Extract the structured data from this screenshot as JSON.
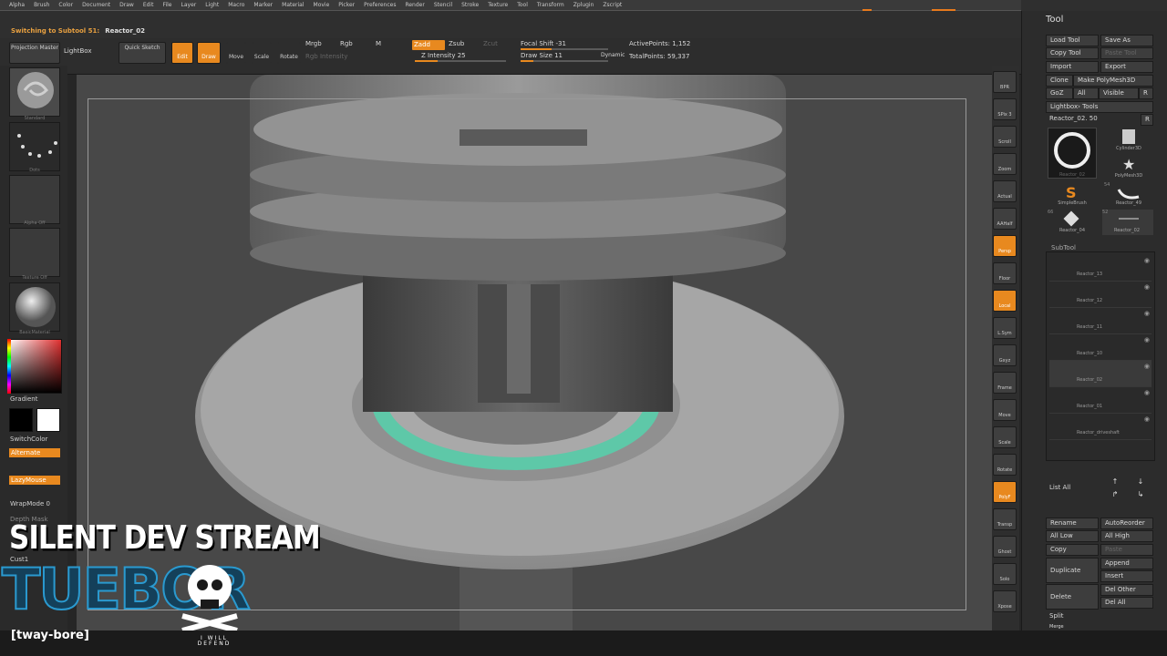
{
  "menu": {
    "items": [
      "Alpha",
      "Brush",
      "Color",
      "Document",
      "Draw",
      "Edit",
      "File",
      "Layer",
      "Light",
      "Macro",
      "Marker",
      "Material",
      "Movie",
      "Picker",
      "Preferences",
      "Render",
      "Stencil",
      "Stroke",
      "Texture",
      "Tool",
      "Transform",
      "Zplugin",
      "Zscript"
    ]
  },
  "status": {
    "prefix": "Switching to Subtool 51:",
    "subtool_name": "Reactor_02"
  },
  "toolbar": {
    "projection_master": "Projection Master",
    "lightbox": "LightBox",
    "quick_sketch": "Quick Sketch",
    "edit": "Edit",
    "draw": "Draw",
    "move": "Move",
    "scale": "Scale",
    "rotate": "Rotate",
    "mrgb": "Mrgb",
    "rgb": "Rgb",
    "m": "M",
    "rgb_intensity": "Rgb Intensity",
    "zadd": "Zadd",
    "zsub": "Zsub",
    "zcut": "Zcut",
    "z_intensity": "Z Intensity 25",
    "focal_shift": "Focal Shift -31",
    "draw_size": "Draw Size 11",
    "dynamic": "Dynamic",
    "active_points": "ActivePoints: 1,152",
    "total_points": "TotalPoints: 59,337",
    "z_intensity_level": 0.25,
    "focal_shift_level": 0.35,
    "draw_size_level": 0.15
  },
  "left_shelf": {
    "brush_label": "Standard",
    "stroke_label": "Dots",
    "alpha_label": "Alpha Off",
    "texture_label": "Texture Off",
    "material_label": "BasicMaterial",
    "gradient": "Gradient",
    "switch_color": "SwitchColor",
    "alternate": "Alternate",
    "lazy_mouse": "LazyMouse",
    "wrap_mode": "WrapMode 0",
    "depth_mask": "Depth Mask",
    "cust1": "Cust1"
  },
  "right_strip": [
    "BPR",
    "SPix 3",
    "Scroll",
    "Zoom",
    "Actual",
    "AAHalf",
    "Persp",
    "Floor",
    "Local",
    "L.Sym",
    "Gxyz",
    "Frame",
    "Move",
    "Scale",
    "Rotate",
    "PolyF",
    "Transp",
    "Ghost",
    "Solo",
    "Xpose"
  ],
  "tool_panel": {
    "title": "Tool",
    "load_tool": "Load Tool",
    "save_as": "Save As",
    "copy_tool": "Copy Tool",
    "paste_tool": "Paste Tool",
    "import": "Import",
    "export": "Export",
    "clone": "Clone",
    "make_polymesh": "Make PolyMesh3D",
    "goz": "GoZ",
    "all": "All",
    "visible": "Visible",
    "r": "R",
    "lightbox_tools": "Lightbox› Tools",
    "current_tool": "Reactor_02. 50",
    "thumbs": [
      {
        "label": "Reactor_02"
      },
      {
        "label": "Cylinder3D"
      },
      {
        "label": "PolyMesh3D"
      },
      {
        "label": "SimpleBrush"
      },
      {
        "label": "Reactor_49"
      },
      {
        "label": "Reactor_04"
      },
      {
        "label": "Reactor_02"
      }
    ],
    "thumb_counts": [
      "54",
      "66",
      "52"
    ],
    "subtool_header": "SubTool",
    "subtools": [
      "Reactor_13",
      "Reactor_12",
      "Reactor_11",
      "Reactor_10",
      "Reactor_02",
      "Reactor_01",
      "Reactor_driveshaft"
    ],
    "list_all": "List All",
    "rename": "Rename",
    "auto_reorder": "AutoReorder",
    "all_low": "All Low",
    "all_high": "All High",
    "copy": "Copy",
    "paste": "Paste",
    "duplicate": "Duplicate",
    "append": "Append",
    "insert": "Insert",
    "delete": "Delete",
    "del_other": "Del Other",
    "del_all": "Del All",
    "split": "Split",
    "merge": "Merge"
  },
  "overlay": {
    "headline": "SILENT DEV STREAM",
    "logo_text": "TUEBOR",
    "pronunciation": "[tway-bore]",
    "motto": "I WILL DEFEND"
  },
  "colors": {
    "accent": "#e8891f",
    "teal_ring": "#5ec8a8",
    "logo_blue": "#1e7fa8"
  }
}
